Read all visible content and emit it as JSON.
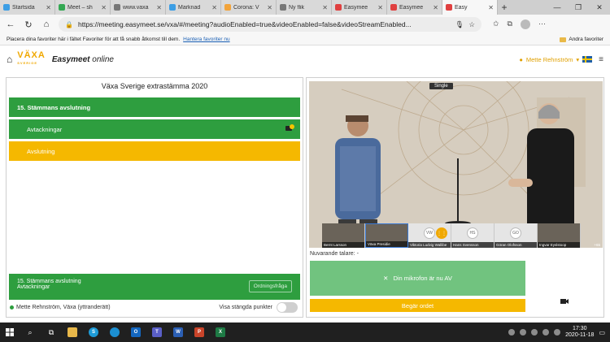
{
  "browser": {
    "tabs": [
      {
        "label": "Startsida",
        "color": "#3c9ee5",
        "active": false
      },
      {
        "label": "Meet – sh",
        "color": "#34a853",
        "active": false
      },
      {
        "label": "www.vaxa",
        "color": "#777777",
        "active": false
      },
      {
        "label": "Marknad",
        "color": "#3c9ee5",
        "active": false
      },
      {
        "label": "Corona: V",
        "color": "#f2a33a",
        "active": false
      },
      {
        "label": "Ny flik",
        "color": "#777777",
        "active": false
      },
      {
        "label": "Easymee",
        "color": "#e04040",
        "active": false
      },
      {
        "label": "Easymee",
        "color": "#e04040",
        "active": false
      },
      {
        "label": "Easy",
        "color": "#e04040",
        "active": true
      }
    ],
    "url": "https://meeting.easymeet.se/vxa/#/meeting?audioEnabled=true&videoEnabled=false&videoStreamEnabled...",
    "favorites_prompt": "Placera dina favoriter här i fältet Favoriter för att få snabb åtkomst till dem.",
    "favorites_link": "Hantera favoriter nu",
    "other_favorites": "Andra favoriter"
  },
  "app": {
    "logo_text": "VÄXA",
    "logo_sub": "SVERIGE",
    "name_bold": "Easymeet",
    "name_rest": " online",
    "user_name": "Mette Rehnström",
    "accent": "#f0a800"
  },
  "agenda": {
    "meeting_title": "Växa Sverige extrastämma 2020",
    "items": [
      {
        "label": "15. Stämmans avslutning",
        "style": "green"
      },
      {
        "label": "Avtackningar",
        "style": "green-indent"
      },
      {
        "label": "Avslutning",
        "style": "yellow-indent"
      }
    ],
    "footer_line1": "15. Stämmans avslutning",
    "footer_line2": "Avtackningar",
    "footer_button": "Ordningsfråga",
    "status_text": "Mette Rehnström, Växa (yttranderätt)",
    "toggle_label": "Visa stängda punkter"
  },
  "video": {
    "mode_label": "Single",
    "participants": [
      {
        "name": "Bernt Larsson",
        "initials": "",
        "dark": true,
        "selected": false
      },
      {
        "name": "Växa Presidie",
        "initials": "",
        "dark": true,
        "selected": true
      },
      {
        "name": "Viktoria Ludvig Wallibe",
        "initials": "VW",
        "dark": false,
        "selected": false
      },
      {
        "name": "Hans Svensson",
        "initials": "HS",
        "dark": false,
        "selected": false
      },
      {
        "name": "Göran Olofsson",
        "initials": "GO",
        "dark": false,
        "selected": false
      },
      {
        "name": "Ingvar Eyslstoop",
        "initials": "",
        "dark": true,
        "selected": false
      }
    ],
    "side_tag": "+65",
    "current_speaker_label": "Nuvarande talare: -",
    "mic_button": "Din mikrofon är nu AV",
    "request_button": "Begär ordet"
  },
  "taskbar": {
    "time": "17:30",
    "date": "2020-11-18"
  }
}
